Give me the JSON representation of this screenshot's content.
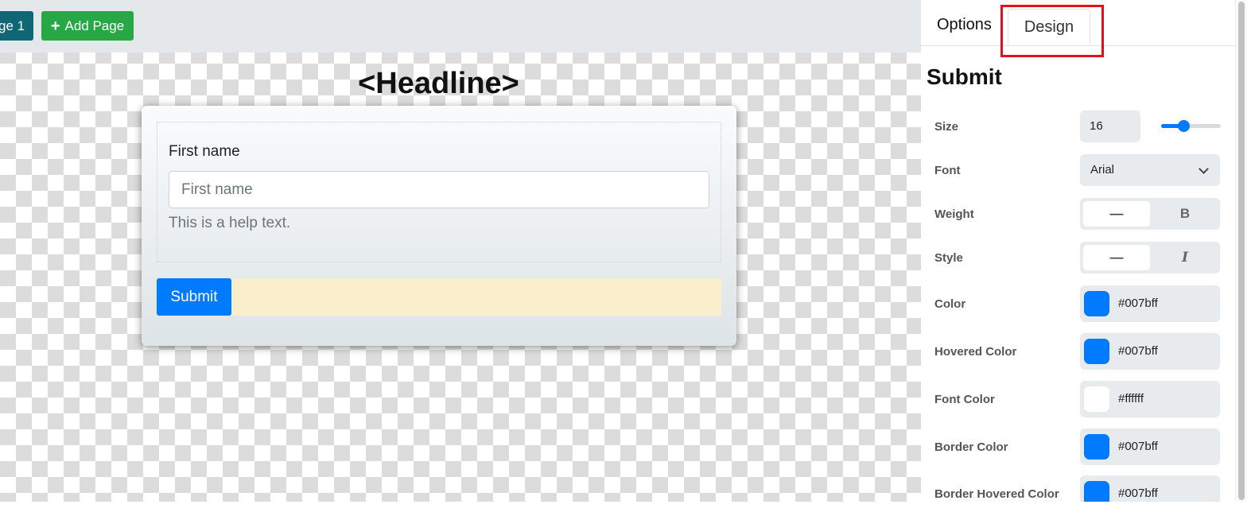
{
  "toolbar": {
    "page_tab_label": "ge 1",
    "add_page_label": "Add Page"
  },
  "canvas": {
    "headline": "<Headline>",
    "form": {
      "field_label": "First name",
      "field_placeholder": "First name",
      "help_text": "This is a help text.",
      "submit_label": "Submit"
    }
  },
  "panel": {
    "tabs": {
      "options": "Options",
      "design": "Design",
      "active": "Design"
    },
    "title": "Submit",
    "size": {
      "label": "Size",
      "value": "16",
      "slider_level": 0.37
    },
    "font": {
      "label": "Font",
      "value": "Arial"
    },
    "weight": {
      "label": "Weight",
      "normal_symbol": "—",
      "bold_symbol": "B",
      "selected": "normal"
    },
    "style": {
      "label": "Style",
      "normal_symbol": "—",
      "italic_symbol": "I",
      "selected": "normal"
    },
    "colors": [
      {
        "label": "Color",
        "hex": "#007bff"
      },
      {
        "label": "Hovered Color",
        "hex": "#007bff"
      },
      {
        "label": "Font Color",
        "hex": "#ffffff"
      },
      {
        "label": "Border Color",
        "hex": "#007bff"
      },
      {
        "label": "Border Hovered Color",
        "hex": "#007bff"
      }
    ]
  },
  "theme": {
    "accent": "#007bff",
    "add_page_green": "#28a745",
    "page_tab_teal": "#0f6674",
    "highlight_red": "#e1101c",
    "submit_row_bg": "#fbeecd"
  }
}
